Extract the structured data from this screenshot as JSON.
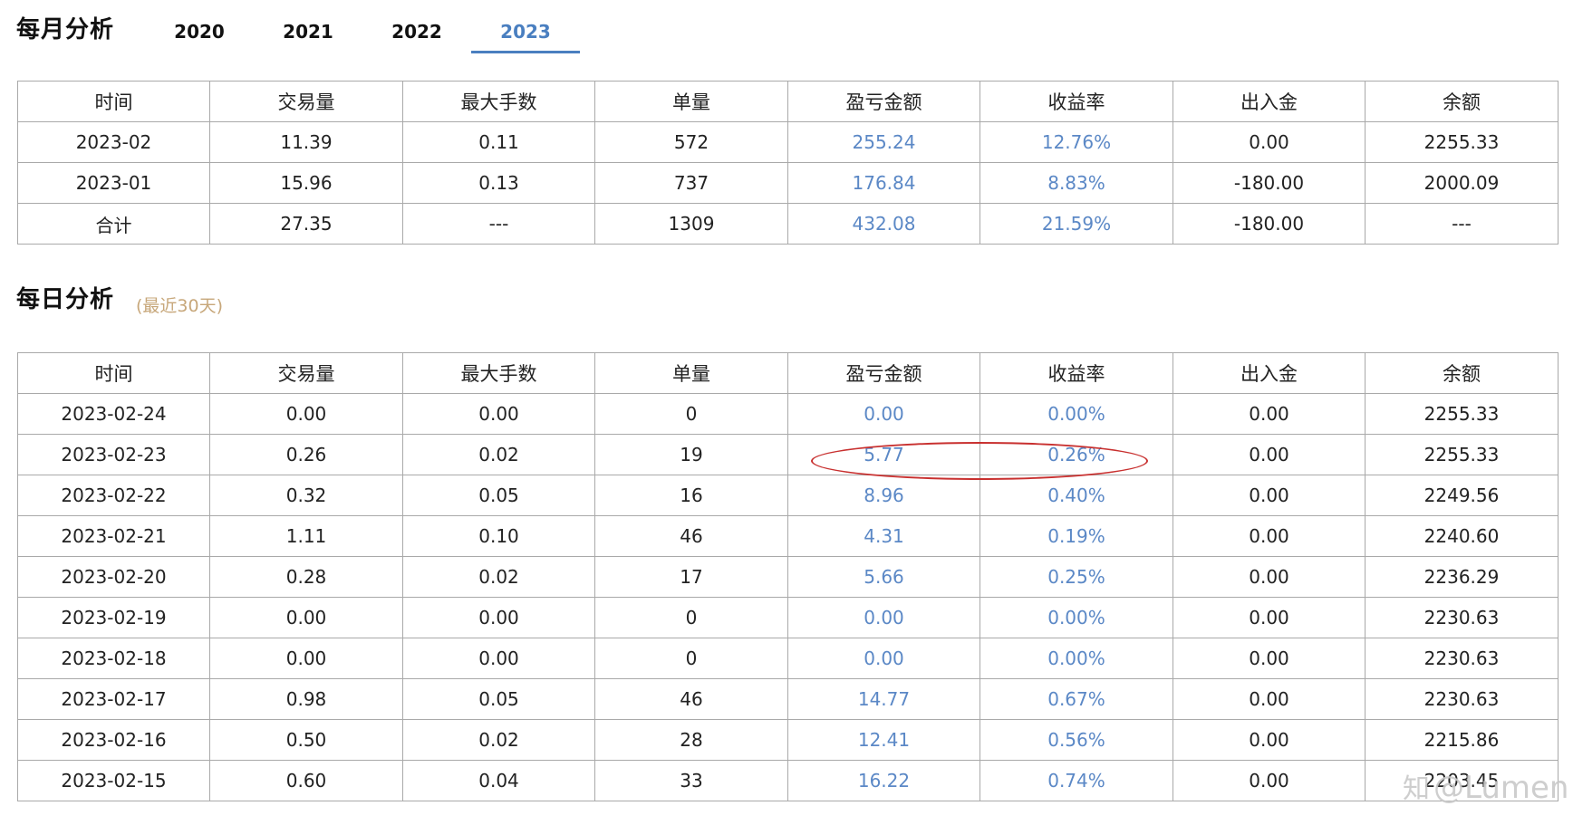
{
  "monthly": {
    "title": "每月分析",
    "tabs": [
      {
        "label": "2020",
        "active": false
      },
      {
        "label": "2021",
        "active": false
      },
      {
        "label": "2022",
        "active": false
      },
      {
        "label": "2023",
        "active": true
      }
    ],
    "headers": [
      "时间",
      "交易量",
      "最大手数",
      "单量",
      "盈亏金额",
      "收益率",
      "出入金",
      "余额"
    ],
    "rows": [
      [
        "2023-02",
        "11.39",
        "0.11",
        "572",
        "255.24",
        "12.76%",
        "0.00",
        "2255.33"
      ],
      [
        "2023-01",
        "15.96",
        "0.13",
        "737",
        "176.84",
        "8.83%",
        "-180.00",
        "2000.09"
      ],
      [
        "合计",
        "27.35",
        "---",
        "1309",
        "432.08",
        "21.59%",
        "-180.00",
        "---"
      ]
    ]
  },
  "daily": {
    "title": "每日分析",
    "subnote": "(最近30天)",
    "headers": [
      "时间",
      "交易量",
      "最大手数",
      "单量",
      "盈亏金额",
      "收益率",
      "出入金",
      "余额"
    ],
    "rows": [
      [
        "2023-02-24",
        "0.00",
        "0.00",
        "0",
        "0.00",
        "0.00%",
        "0.00",
        "2255.33"
      ],
      [
        "2023-02-23",
        "0.26",
        "0.02",
        "19",
        "5.77",
        "0.26%",
        "0.00",
        "2255.33"
      ],
      [
        "2023-02-22",
        "0.32",
        "0.05",
        "16",
        "8.96",
        "0.40%",
        "0.00",
        "2249.56"
      ],
      [
        "2023-02-21",
        "1.11",
        "0.10",
        "46",
        "4.31",
        "0.19%",
        "0.00",
        "2240.60"
      ],
      [
        "2023-02-20",
        "0.28",
        "0.02",
        "17",
        "5.66",
        "0.25%",
        "0.00",
        "2236.29"
      ],
      [
        "2023-02-19",
        "0.00",
        "0.00",
        "0",
        "0.00",
        "0.00%",
        "0.00",
        "2230.63"
      ],
      [
        "2023-02-18",
        "0.00",
        "0.00",
        "0",
        "0.00",
        "0.00%",
        "0.00",
        "2230.63"
      ],
      [
        "2023-02-17",
        "0.98",
        "0.05",
        "46",
        "14.77",
        "0.67%",
        "0.00",
        "2230.63"
      ],
      [
        "2023-02-16",
        "0.50",
        "0.02",
        "28",
        "12.41",
        "0.56%",
        "0.00",
        "2215.86"
      ],
      [
        "2023-02-15",
        "0.60",
        "0.04",
        "33",
        "16.22",
        "0.74%",
        "0.00",
        "2203.45"
      ]
    ]
  },
  "watermark": {
    "text": "@Lumen",
    "icon": "zhihu-icon"
  },
  "colors": {
    "accent": "#4a7fc0",
    "value_blue": "#5b88c6",
    "subnote": "#c7a77a",
    "highlight": "#c8302f"
  }
}
